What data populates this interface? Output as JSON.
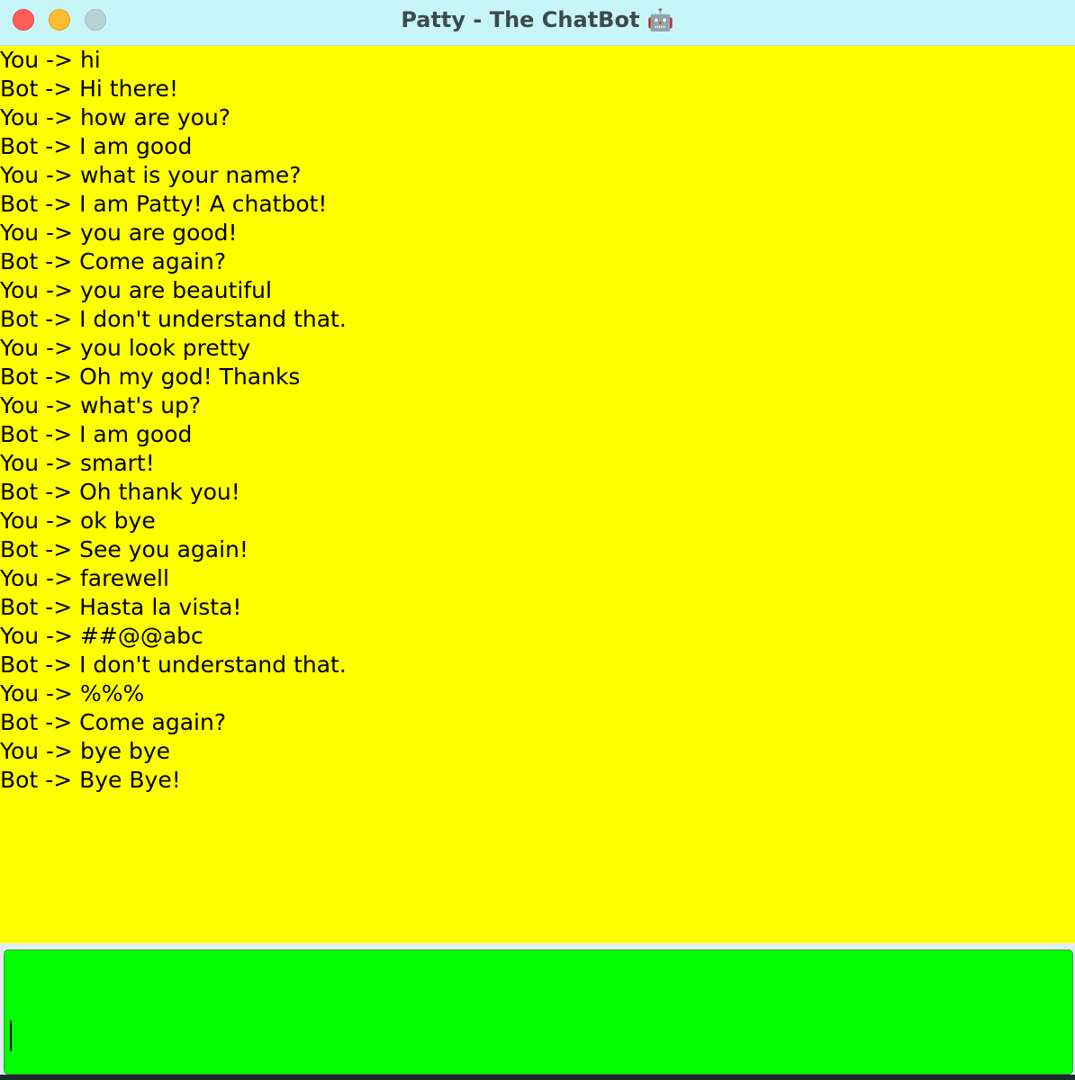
{
  "window": {
    "title": "Patty - The ChatBot 🤖"
  },
  "chat": {
    "messages": [
      "You -> hi",
      "Bot -> Hi there!",
      "You -> how are you?",
      "Bot -> I am good",
      "You -> what is your name?",
      "Bot -> I am Patty! A chatbot!",
      "You -> you are good!",
      "Bot -> Come again?",
      "You -> you are beautiful",
      "Bot -> I don't understand that.",
      "You -> you look pretty",
      "Bot -> Oh my god! Thanks",
      "You -> what's up?",
      "Bot -> I am good",
      "You -> smart!",
      "Bot -> Oh thank you!",
      "You -> ok bye",
      "Bot -> See you again!",
      "You -> farewell",
      "Bot -> Hasta la vista!",
      "You -> ##@@abc",
      "Bot -> I don't understand that.",
      "You -> %%%",
      "Bot -> Come again?",
      "You -> bye bye",
      "Bot -> Bye Bye!"
    ]
  },
  "input": {
    "value": ""
  },
  "colors": {
    "chat_background": "#ffff00",
    "input_background": "#00ff00",
    "titlebar": "#c8f6f8"
  }
}
